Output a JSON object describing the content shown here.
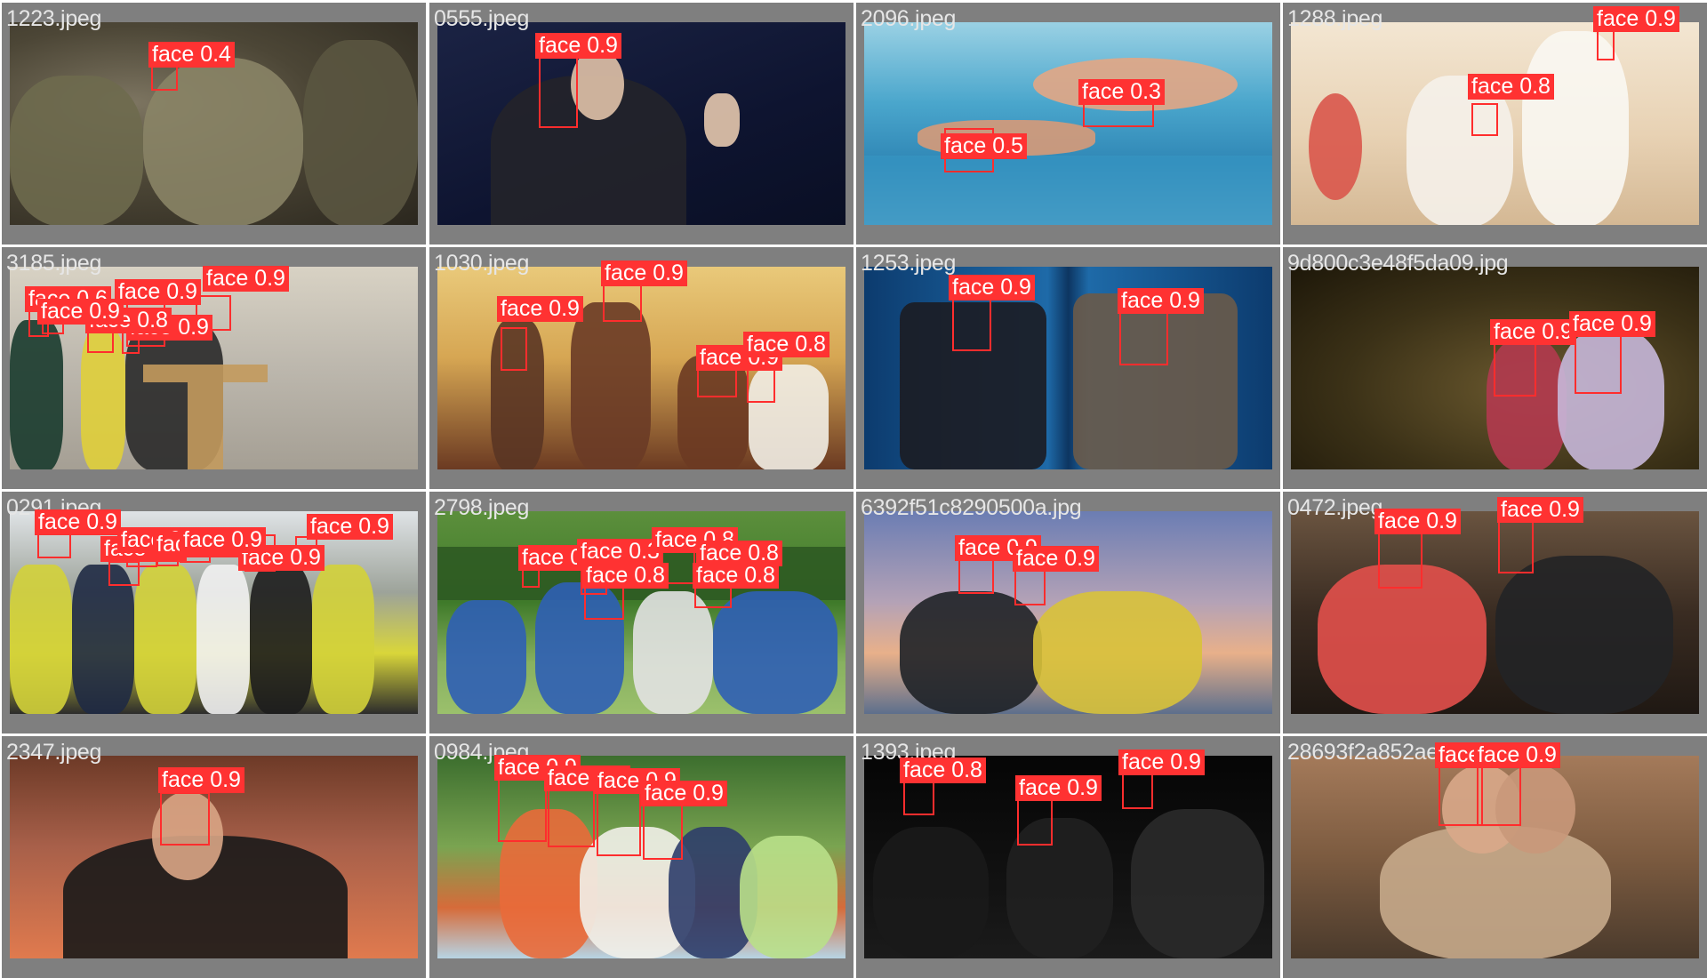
{
  "colors": {
    "box": "#ff2d2d",
    "tag_bg": "#ff3232",
    "cell_bg": "#7f7f7f"
  },
  "tiles": [
    {
      "file": "1223.jpeg",
      "scene": "soldiers",
      "detections": [
        {
          "label": "face 0.4"
        }
      ]
    },
    {
      "file": "0555.jpeg",
      "scene": "yale",
      "detections": [
        {
          "label": "face 0.9"
        }
      ]
    },
    {
      "file": "2096.jpeg",
      "scene": "swimmer",
      "detections": [
        {
          "label": "face 0.5"
        },
        {
          "label": "face 0.3"
        }
      ]
    },
    {
      "file": "1288.jpeg",
      "scene": "spa",
      "detections": [
        {
          "label": "face 0.9"
        },
        {
          "label": "face 0.8"
        }
      ]
    },
    {
      "file": "3185.jpeg",
      "scene": "podium",
      "detections": [
        {
          "label": "face 0.9"
        },
        {
          "label": "face 0.6"
        },
        {
          "label": "face 0.9"
        },
        {
          "label": "face 0.8"
        },
        {
          "label": "face 0.9"
        },
        {
          "label": "face 0.9"
        }
      ]
    },
    {
      "file": "1030.jpeg",
      "scene": "vintage",
      "detections": [
        {
          "label": "face 0.9"
        },
        {
          "label": "face 0.9"
        },
        {
          "label": "face 0.9"
        },
        {
          "label": "face 0.8"
        }
      ]
    },
    {
      "file": "1253.jpeg",
      "scene": "tvsplit",
      "detections": [
        {
          "label": "face 0.9"
        },
        {
          "label": "face 0.9"
        }
      ]
    },
    {
      "file": "9d800c3e48f5da09.jpg",
      "scene": "cave",
      "detections": [
        {
          "label": "face 0.9"
        },
        {
          "label": "face 0.9"
        }
      ]
    },
    {
      "file": "0291.jpeg",
      "scene": "crowd",
      "detections": [
        {
          "label": "face 0.9"
        },
        {
          "label": "face 0.9"
        },
        {
          "label": "face 0.9"
        },
        {
          "label": "face 0.9"
        },
        {
          "label": "face 0.9"
        },
        {
          "label": "face 0.9"
        },
        {
          "label": "face 0.9"
        }
      ]
    },
    {
      "file": "2798.jpeg",
      "scene": "soccer",
      "detections": [
        {
          "label": "face 0.9"
        },
        {
          "label": "face 0.3"
        },
        {
          "label": "face 0.8"
        },
        {
          "label": "face 0.8"
        },
        {
          "label": "face 0.8"
        },
        {
          "label": "face 0.8"
        }
      ]
    },
    {
      "file": "6392f51c8290500a.jpg",
      "scene": "sunset",
      "detections": [
        {
          "label": "face 0.9"
        },
        {
          "label": "face 0.9"
        }
      ]
    },
    {
      "file": "0472.jpeg",
      "scene": "interview",
      "detections": [
        {
          "label": "face 0.9"
        },
        {
          "label": "face 0.9"
        }
      ]
    },
    {
      "file": "2347.jpeg",
      "scene": "matador",
      "detections": [
        {
          "label": "face 0.9"
        }
      ]
    },
    {
      "file": "0984.jpeg",
      "scene": "family",
      "detections": [
        {
          "label": "face 0.9"
        },
        {
          "label": "face 0.9"
        },
        {
          "label": "face 0.9"
        },
        {
          "label": "face 0.9"
        }
      ]
    },
    {
      "file": "1393.jpeg",
      "scene": "band",
      "detections": [
        {
          "label": "face 0.8"
        },
        {
          "label": "face 0.9"
        },
        {
          "label": "face 0.9"
        }
      ]
    },
    {
      "file": "28693f2a852ae",
      "scene": "hug",
      "detections": [
        {
          "label": "face 0.9"
        },
        {
          "label": "face 0.9"
        }
      ]
    }
  ]
}
